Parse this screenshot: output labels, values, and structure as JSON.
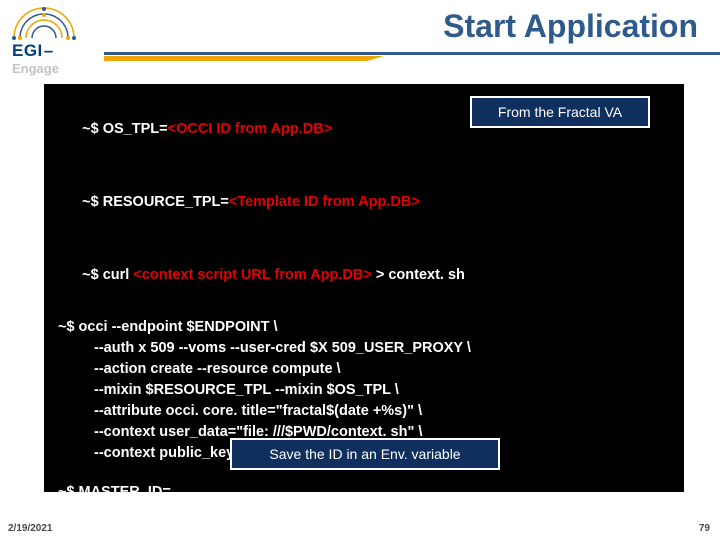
{
  "header": {
    "logo_egi": "EGI",
    "logo_dash": "–",
    "logo_engage": "Engage",
    "title": "Start Application"
  },
  "term": {
    "line1_pre": "~$ OS_TPL=",
    "line1_red": "<OCCI ID from App.DB>",
    "callout_fractal": "From the Fractal VA",
    "line2_pre": "~$ RESOURCE_TPL=",
    "line2_red": "<Template ID from App.DB>",
    "line3_pre": "~$ curl ",
    "line3_red": "<context script URL from App.DB>",
    "line3_post": " > context. sh",
    "occi": {
      "l0": "~$ occi --endpoint $ENDPOINT \\",
      "l1": "--auth x 509 --voms --user-cred $X 509_USER_PROXY \\",
      "l2": "--action create --resource compute \\",
      "l3": "--mixin $RESOURCE_TPL --mixin $OS_TPL \\",
      "l4": "--attribute occi. core. title=\"fractal$(date +%s)\" \\",
      "l5": "--context user_data=\"file: ///$PWD/context. sh\" \\",
      "l6": "--context public_key=\"file: ///$HOME/. ssh/id_rsa. pub\""
    },
    "master": "~$ MASTER_ID=. . .",
    "callout_save": "Save the ID in an Env. variable"
  },
  "footer": {
    "date": "2/19/2021",
    "page": "79"
  }
}
